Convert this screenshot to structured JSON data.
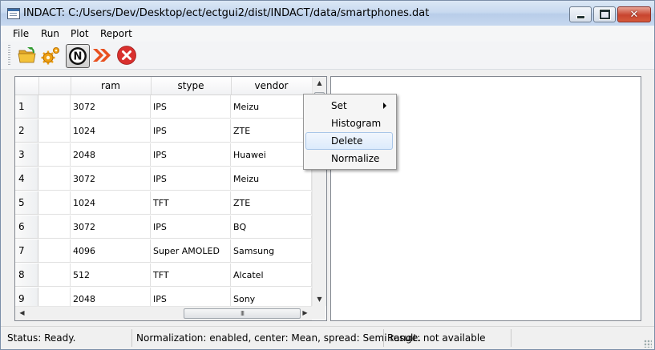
{
  "window": {
    "title": "INDACT: C:/Users/Dev/Desktop/ect/ectgui2/dist/INDACT/data/smartphones.dat",
    "controls": [
      "minimize",
      "maximize",
      "close"
    ],
    "close_glyph": "✕"
  },
  "menubar": {
    "items": [
      "File",
      "Run",
      "Plot",
      "Report"
    ]
  },
  "toolbar": {
    "buttons": [
      {
        "icon": "open-folder-icon"
      },
      {
        "icon": "settings-gears-icon"
      },
      {
        "icon": "normalize-n-icon",
        "selected": true
      },
      {
        "icon": "run-forward-icon"
      },
      {
        "icon": "stop-cancel-icon"
      }
    ]
  },
  "table": {
    "columns": [
      "",
      "ram",
      "stype",
      "vendor"
    ],
    "rows": [
      {
        "num": "1",
        "cells": [
          "",
          "3072",
          "IPS",
          "Meizu"
        ]
      },
      {
        "num": "2",
        "cells": [
          "",
          "1024",
          "IPS",
          "ZTE"
        ]
      },
      {
        "num": "3",
        "cells": [
          "",
          "2048",
          "IPS",
          "Huawei"
        ]
      },
      {
        "num": "4",
        "cells": [
          "",
          "3072",
          "IPS",
          "Meizu"
        ]
      },
      {
        "num": "5",
        "cells": [
          "",
          "1024",
          "TFT",
          "ZTE"
        ]
      },
      {
        "num": "6",
        "cells": [
          "",
          "3072",
          "IPS",
          "BQ"
        ]
      },
      {
        "num": "7",
        "cells": [
          "",
          "4096",
          "Super AMOLED",
          "Samsung"
        ]
      },
      {
        "num": "8",
        "cells": [
          "",
          "512",
          "TFT",
          "Alcatel"
        ]
      },
      {
        "num": "9",
        "cells": [
          "",
          "2048",
          "IPS",
          "Sony"
        ]
      }
    ],
    "scroll_glyphs": {
      "up": "▲",
      "down": "▼",
      "left": "◀",
      "right": "▶",
      "grip": "III"
    }
  },
  "context_menu": {
    "items": [
      {
        "label": "Set",
        "submenu": true
      },
      {
        "label": "Histogram"
      },
      {
        "label": "Delete",
        "highlighted": true
      },
      {
        "label": "Normalize"
      }
    ]
  },
  "statusbar": {
    "status": "Status: Ready.",
    "normalization": "Normalization: enabled, center: Mean, spread: Semi range.",
    "result": "Result: not available"
  },
  "colors": {
    "close_button": "#c8452f",
    "highlight_border": "#a8c6e8",
    "stop_icon": "#d9302e",
    "forward_icon": "#e8501f",
    "gear_icon": "#f0a010",
    "folder_icon": "#f3c23a"
  }
}
